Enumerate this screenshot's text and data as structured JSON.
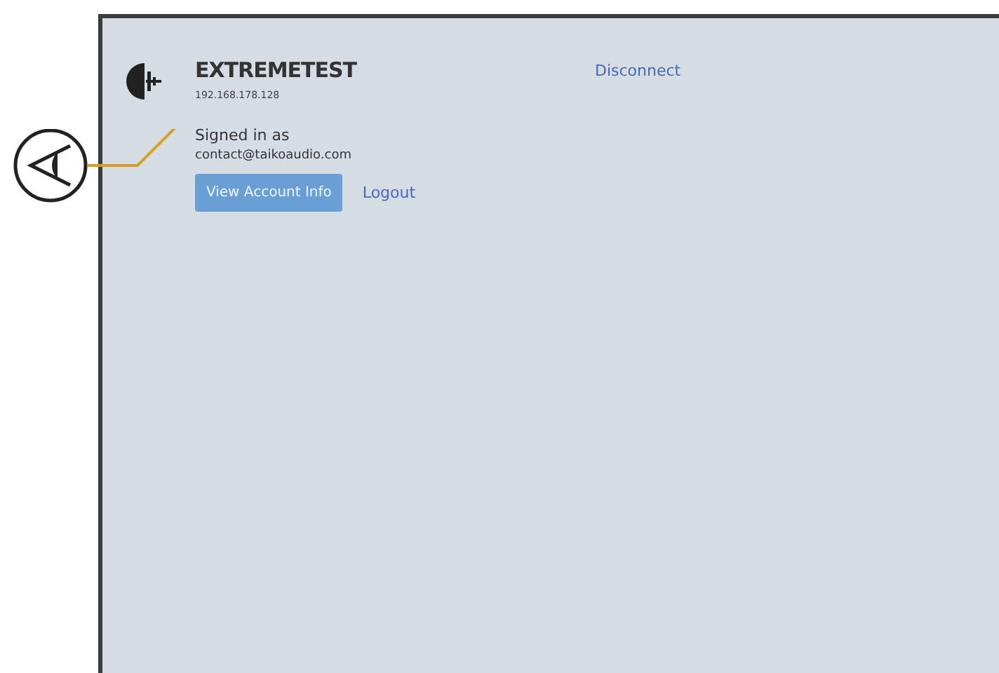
{
  "device": {
    "name": "EXTREMETEST",
    "ip": "192.168.178.128",
    "disconnect": "Disconnect"
  },
  "account": {
    "signed_in_label": "Signed in as",
    "email": "contact@taikoaudio.com",
    "buttons": [
      "View Account Info",
      "Logout"
    ]
  }
}
